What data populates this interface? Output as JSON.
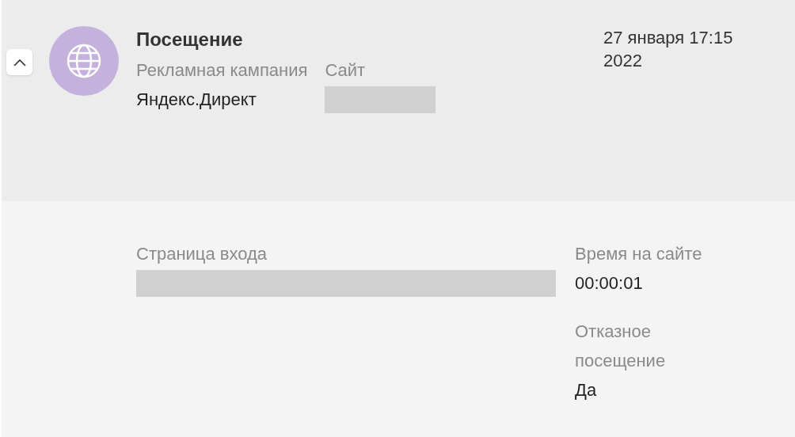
{
  "collapse_button": {
    "expanded": true
  },
  "visit": {
    "title": "Посещение",
    "date": "27 января 17:15",
    "year": "2022"
  },
  "header_fields": [
    {
      "label": "Рекламная кампания",
      "value": "Яндекс.Директ",
      "redacted": false
    },
    {
      "label": "Сайт",
      "redacted": true
    }
  ],
  "detail_fields": [
    {
      "label": "Страница входа",
      "redacted": true
    }
  ],
  "side_fields": [
    {
      "label": "Время на сайте",
      "value": "00:00:01",
      "redacted": false
    },
    {
      "label": "Отказное посещение",
      "value": "Да",
      "redacted": false
    }
  ]
}
